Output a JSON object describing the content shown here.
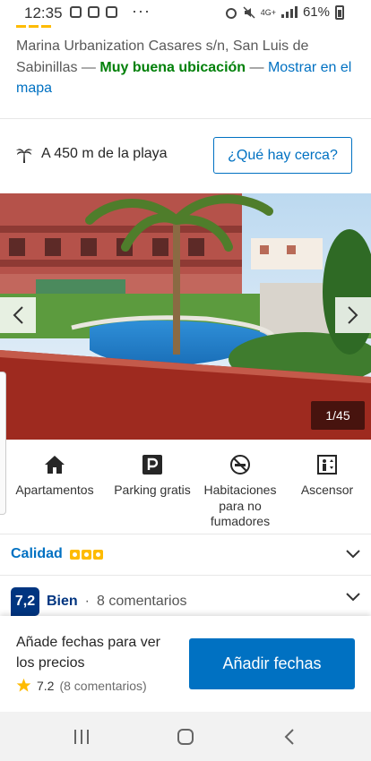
{
  "status_bar": {
    "time": "12:35",
    "network": "4G+",
    "battery": "61%"
  },
  "address": {
    "text": "Marina Urbanization Casares s/n, San Luis de Sabinillas",
    "separator": " — ",
    "location_label": "Muy buena ubicación",
    "map_link": "Mostrar en el mapa"
  },
  "beach": {
    "icon": "palm-tree-icon",
    "text": "A 450 m de la playa"
  },
  "nearby_button": "¿Qué hay cerca?",
  "gallery": {
    "counter": "1/45",
    "prev_icon": "chevron-left-icon",
    "next_icon": "chevron-right-icon"
  },
  "amenities": [
    {
      "icon": "house-icon",
      "label": "Apartamentos"
    },
    {
      "icon": "parking-icon",
      "label": "Parking gratis"
    },
    {
      "icon": "no-smoking-icon",
      "label": "Habitaciones para no fumadores"
    },
    {
      "icon": "elevator-icon",
      "label": "Ascensor"
    }
  ],
  "quality": {
    "label": "Calidad",
    "stars": 3
  },
  "review": {
    "score": "7,2",
    "word": "Bien",
    "separator": "·",
    "count": "8 comentarios"
  },
  "booking_bar": {
    "text": "Añade fechas para ver los precios",
    "rating": "7.2",
    "rating_count": "(8 comentarios)",
    "button": "Añadir fechas"
  },
  "colors": {
    "brand_blue": "#0071c2",
    "dark_blue": "#003580",
    "green": "#008009",
    "yellow": "#febb02"
  }
}
